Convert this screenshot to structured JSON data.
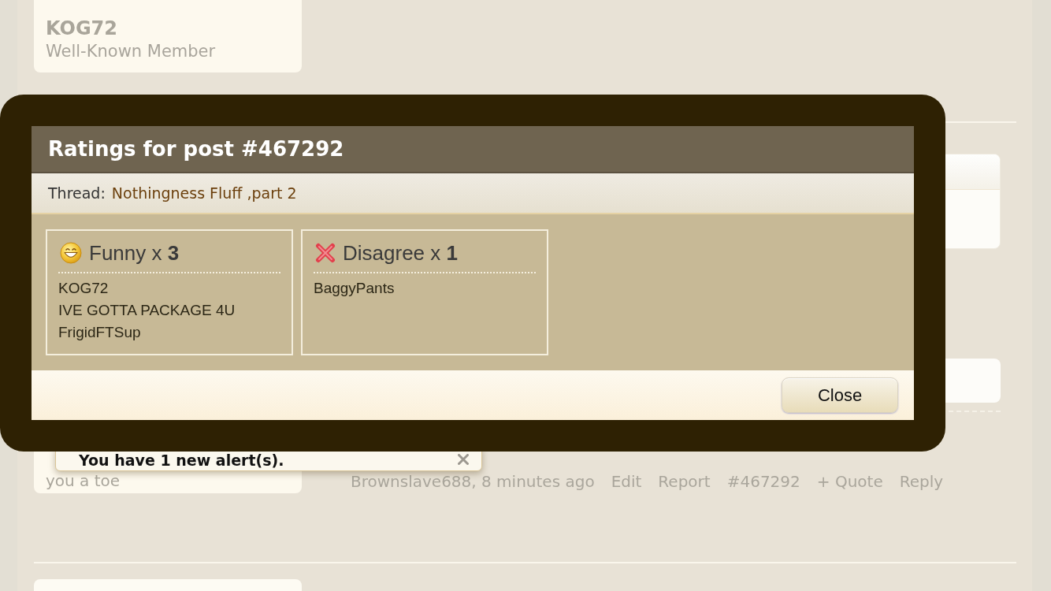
{
  "background": {
    "user_card": {
      "name": "KOG72",
      "title": "Well-Known Member"
    },
    "side_card_text": "you a toe",
    "post_footer": {
      "byline": "Brownslave688, 8 minutes ago",
      "actions": [
        "Edit",
        "Report",
        "#467292",
        "+ Quote",
        "Reply"
      ]
    }
  },
  "alert": {
    "text": "You have 1 new alert(s)."
  },
  "dialog": {
    "title": "Ratings for post #467292",
    "thread": {
      "label": "Thread:",
      "title": "Nothingness Fluff ,part 2"
    },
    "ratings": [
      {
        "kind": "funny",
        "heading": "Funny x **3**",
        "users": [
          "KOG72",
          "IVE GOTTA PACKAGE 4U",
          "FrigidFTSup"
        ]
      },
      {
        "kind": "disagree",
        "heading": "Disagree x **1**",
        "users": [
          "BaggyPants"
        ]
      }
    ],
    "close_button": "Close"
  }
}
